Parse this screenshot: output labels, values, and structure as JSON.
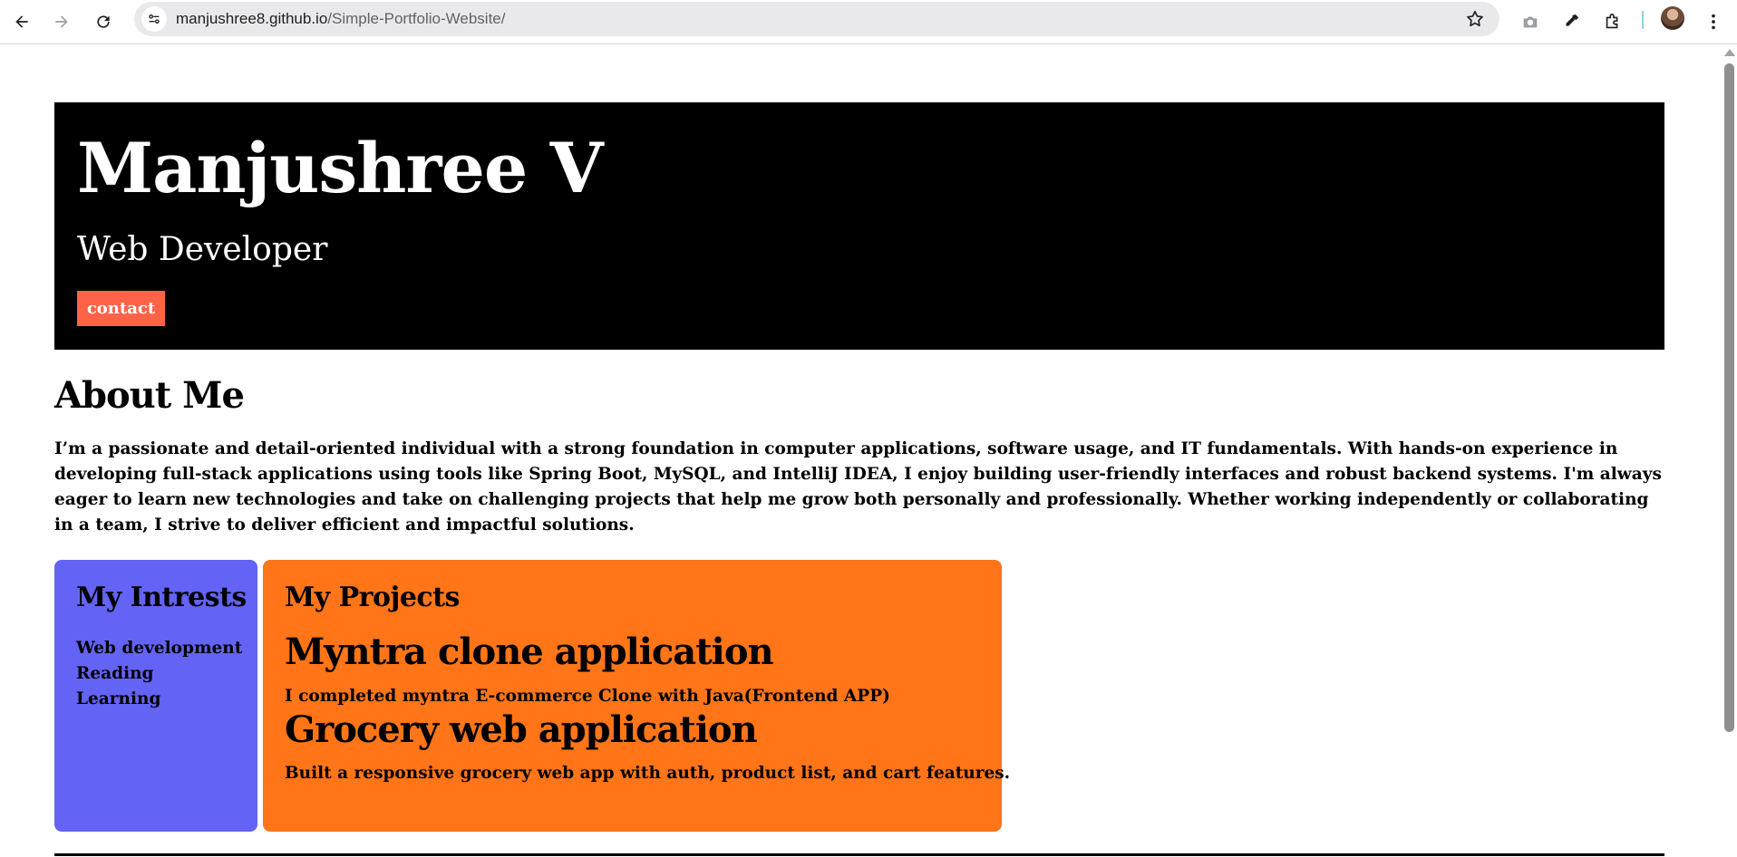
{
  "browser": {
    "url_host": "manjushree8.github.io",
    "url_path": "/Simple-Portfolio-Website/",
    "icons": [
      "back-icon",
      "forward-icon",
      "reload-icon",
      "site-info-icon",
      "star-icon",
      "camera-icon",
      "eyedropper-icon",
      "extensions-icon",
      "profile-avatar",
      "more-icon"
    ]
  },
  "hero": {
    "name": "Manjushree V",
    "role": "Web Developer",
    "contact_label": "contact"
  },
  "about": {
    "title": "About Me",
    "text": "I’m a passionate and detail-oriented individual with a strong foundation in computer applications, software usage, and IT fundamentals. With hands-on experience in developing full-stack applications using tools like Spring Boot, MySQL, and IntelliJ IDEA, I enjoy building user-friendly interfaces and robust backend systems. I'm always eager to learn new technologies and take on challenging projects that help me grow both personally and professionally. Whether working independently or collaborating in a team, I strive to deliver efficient and impactful solutions."
  },
  "interests": {
    "title": "My Intrests",
    "items": [
      "Web development",
      "Reading",
      "Learning"
    ]
  },
  "projects": {
    "title": "My Projects",
    "items": [
      {
        "name": "Myntra clone application",
        "description": "I completed myntra E-commerce Clone with Java(Frontend APP)"
      },
      {
        "name": "Grocery web application",
        "description": "Built a responsive grocery web app with auth, product list, and cart features."
      }
    ]
  },
  "colors": {
    "hero_bg": "#000000",
    "contact_bg": "#ff6347",
    "interests_bg": "#6363f6",
    "projects_bg": "#ff7518"
  }
}
